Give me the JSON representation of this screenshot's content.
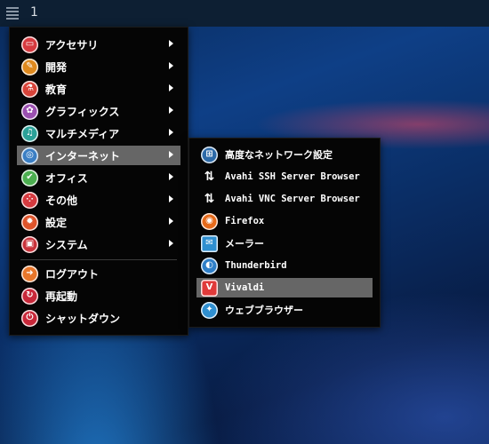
{
  "topbar": {
    "workspace": "1",
    "menu_icon": "hamburger-icon"
  },
  "main_menu": {
    "items": [
      {
        "label": "アクセサリ",
        "icon": "accessories-icon",
        "color": "#d63a3f",
        "has_submenu": true
      },
      {
        "label": "開発",
        "icon": "development-icon",
        "color": "#e08a1e",
        "has_submenu": true
      },
      {
        "label": "教育",
        "icon": "education-icon",
        "color": "#d8443a",
        "has_submenu": true
      },
      {
        "label": "グラフィックス",
        "icon": "graphics-icon",
        "color": "#9b4fb0",
        "has_submenu": true
      },
      {
        "label": "マルチメディア",
        "icon": "multimedia-icon",
        "color": "#2aa198",
        "has_submenu": true
      },
      {
        "label": "インターネット",
        "icon": "internet-icon",
        "color": "#3b7fc4",
        "has_submenu": true,
        "highlighted": true
      },
      {
        "label": "オフィス",
        "icon": "office-icon",
        "color": "#4caf50",
        "has_submenu": true
      },
      {
        "label": "その他",
        "icon": "other-icon",
        "color": "#d63a3f",
        "has_submenu": true
      },
      {
        "label": "設定",
        "icon": "settings-icon",
        "color": "#e0542a",
        "has_submenu": true
      },
      {
        "label": "システム",
        "icon": "system-icon",
        "color": "#c8323a",
        "has_submenu": true
      }
    ],
    "session_items": [
      {
        "label": "ログアウト",
        "icon": "logout-icon",
        "color": "#e8762a"
      },
      {
        "label": "再起動",
        "icon": "reboot-icon",
        "color": "#c8283a"
      },
      {
        "label": "シャットダウン",
        "icon": "shutdown-icon",
        "color": "#c8283a"
      }
    ]
  },
  "internet_submenu": {
    "items": [
      {
        "label": "高度なネットワーク設定",
        "icon": "network-icon",
        "color": "#2d6aa8",
        "mono": false
      },
      {
        "label": "Avahi SSH Server Browser",
        "icon": "transfer-arrows-icon",
        "color": "",
        "mono": true
      },
      {
        "label": "Avahi VNC Server Browser",
        "icon": "transfer-arrows-icon",
        "color": "",
        "mono": true
      },
      {
        "label": "Firefox",
        "icon": "firefox-icon",
        "color": "#e66a1a",
        "mono": true
      },
      {
        "label": "メーラー",
        "icon": "mail-icon",
        "color": "#2f8fd0",
        "mono": false
      },
      {
        "label": "Thunderbird",
        "icon": "thunderbird-icon",
        "color": "#2f7fc8",
        "mono": true
      },
      {
        "label": "Vivaldi",
        "icon": "vivaldi-icon",
        "color": "#e03a3a",
        "mono": true,
        "highlighted": true
      },
      {
        "label": "ウェブブラウザー",
        "icon": "web-browser-icon",
        "color": "#2f8fd0",
        "mono": false
      }
    ]
  }
}
